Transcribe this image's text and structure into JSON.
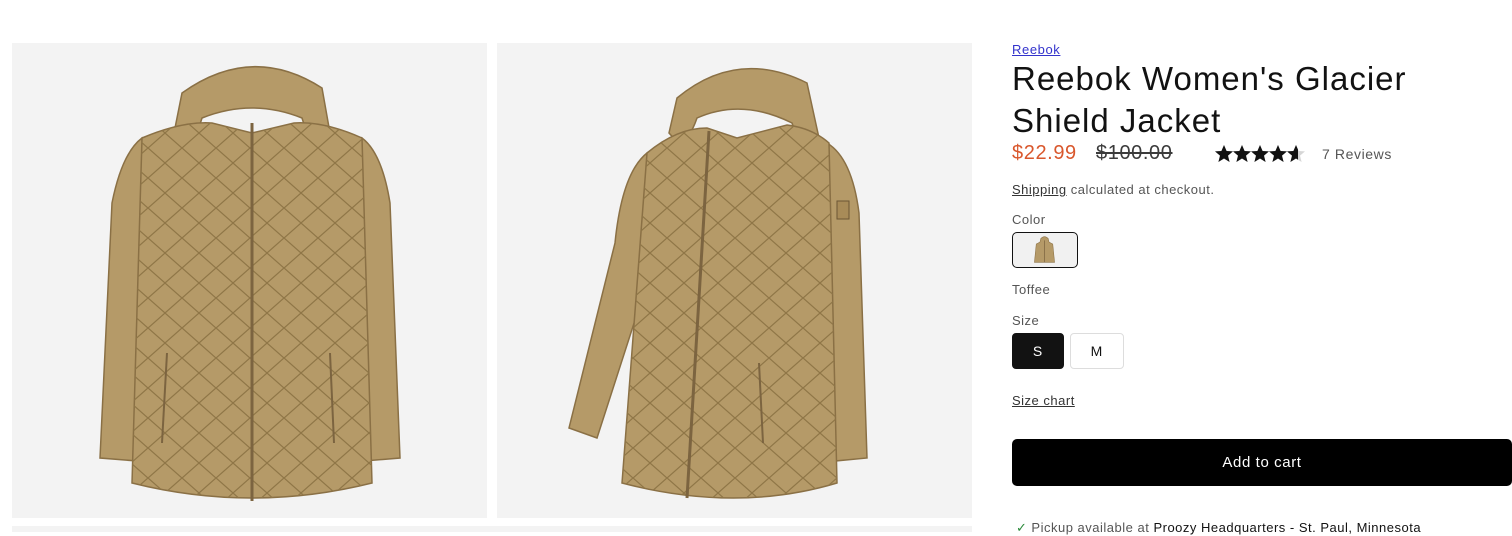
{
  "gallery": {
    "images": [
      {
        "alt": "Reebok Women's Glacier Shield Jacket front view",
        "icon": "jacket-front"
      },
      {
        "alt": "Reebok Women's Glacier Shield Jacket angled view",
        "icon": "jacket-angled"
      }
    ]
  },
  "product": {
    "vendor": "Reebok",
    "title": "Reebok Women's Glacier Shield Jacket",
    "price_sale": "$22.99",
    "price_compare": "$100.00",
    "rating": 4.6,
    "rating_max": 5,
    "reviews_label": "7 Reviews",
    "shipping_link": "Shipping",
    "shipping_text": "calculated at checkout.",
    "color_label": "Color",
    "color_selected": "Toffee",
    "size_label": "Size",
    "sizes": [
      {
        "label": "S",
        "selected": true
      },
      {
        "label": "M",
        "selected": false
      }
    ],
    "size_chart_label": "Size chart",
    "add_to_cart": "Add to cart",
    "pickup_prefix": "Pickup available at",
    "pickup_location": "Proozy Headquarters - St. Paul, Minnesota"
  },
  "colors": {
    "sale_price": "#d9572c",
    "button_bg": "#000000",
    "jacket": "#b59a68",
    "check": "#2a8a3a"
  }
}
